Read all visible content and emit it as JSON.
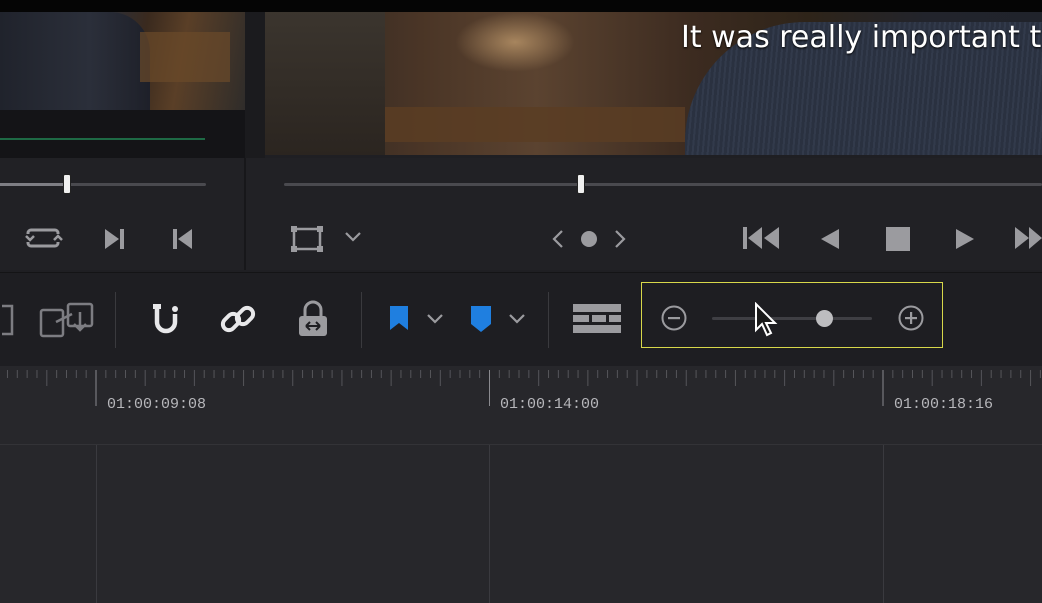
{
  "viewer": {
    "subtitle": "It was really important t"
  },
  "source_viewer": {
    "scrub_progress": 0.32
  },
  "program_viewer": {
    "scrub_progress": 0.39
  },
  "timeline": {
    "timecodes": [
      "01:00:09:08",
      "01:00:14:00",
      "01:00:18:16"
    ]
  },
  "toolbar": {
    "zoom_level": 0.7,
    "flag_color": "#1f7fe0",
    "marker_color": "#1f7fe0",
    "highlight_color": "#d8d84a"
  },
  "icons": {
    "loop": "loop-icon",
    "next_clip": "next-clip-icon",
    "prev_clip": "prev-clip-icon",
    "viewer_size": "viewer-size-icon",
    "prev_frame": "chevron-left-icon",
    "jog": "jog-dot-icon",
    "next_frame": "chevron-right-icon",
    "go_start": "go-to-start-icon",
    "reverse": "play-reverse-icon",
    "stop": "stop-icon",
    "play": "play-icon",
    "go_end": "go-to-end-icon",
    "insert": "insert-clip-icon",
    "replace": "replace-clip-icon",
    "snapping": "snapping-magnet-icon",
    "linked": "link-icon",
    "lock": "position-lock-icon",
    "flag": "flag-icon",
    "marker": "marker-icon",
    "track_height": "track-height-icon",
    "zoom_out": "zoom-out-icon",
    "zoom_in": "zoom-in-icon"
  }
}
